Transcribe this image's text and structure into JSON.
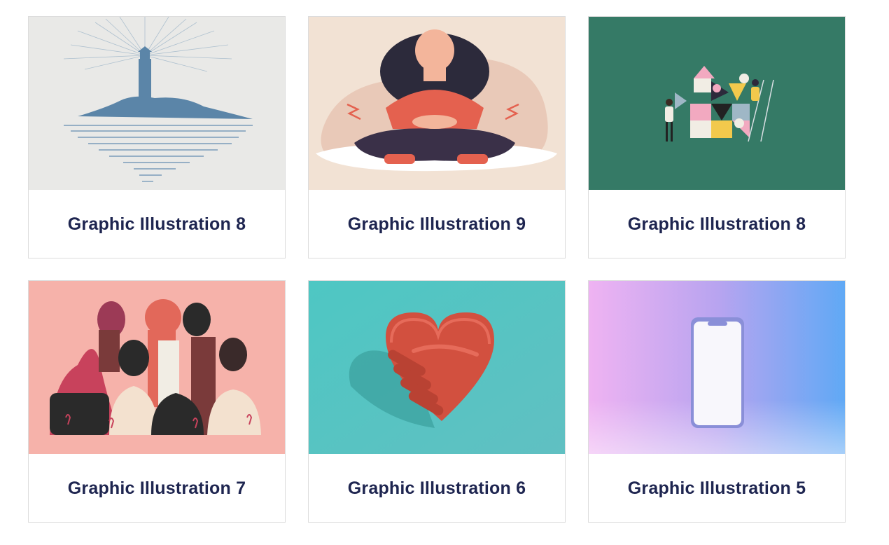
{
  "cards": [
    {
      "title": "Graphic Illustration 8",
      "image": "lighthouse-island-illustration",
      "bg": "#e9e9e7",
      "accent": "#5b85a8"
    },
    {
      "title": "Graphic Illustration 9",
      "image": "woman-meditating-illustration",
      "bg": "#f2e2d4",
      "accent": "#e4614f"
    },
    {
      "title": "Graphic Illustration 8",
      "image": "people-building-blocks-illustration",
      "bg": "#357a66",
      "accent": "#f2c94c"
    },
    {
      "title": "Graphic Illustration 7",
      "image": "women-breast-cancer-awareness-illustration",
      "bg": "#f6b2aa",
      "accent": "#c8425c"
    },
    {
      "title": "Graphic Illustration 6",
      "image": "handshake-heart-illustration",
      "bg": "#4fc1c0",
      "accent": "#d2503f"
    },
    {
      "title": "Graphic Illustration 5",
      "image": "smartphone-gradient-illustration",
      "bg": "#b8a4f0",
      "accent": "#ffffff"
    }
  ],
  "colors": {
    "title_text": "#1e2550",
    "card_border": "#dcdcdc"
  }
}
